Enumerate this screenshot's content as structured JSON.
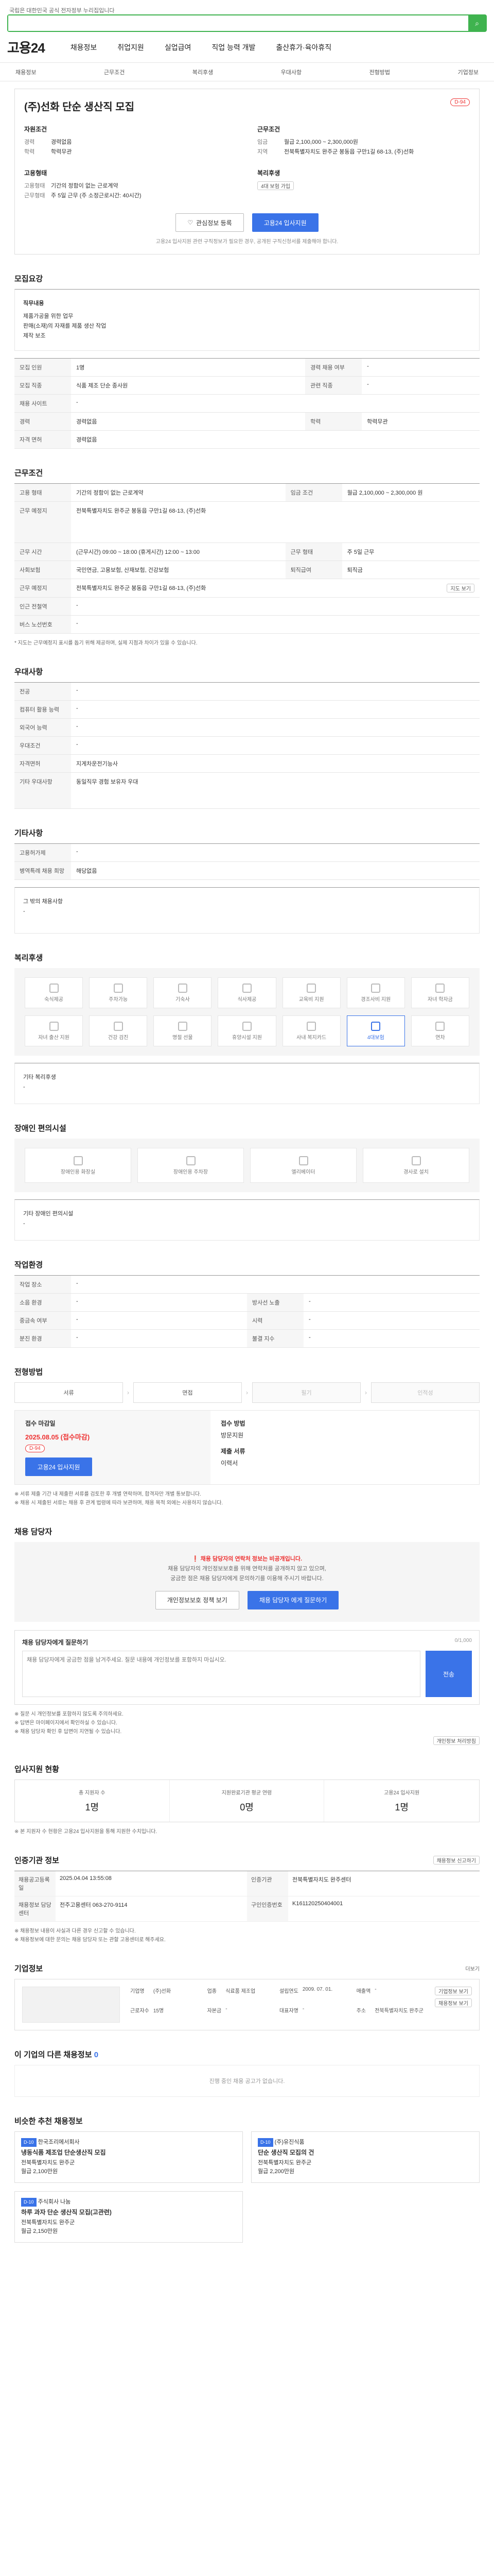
{
  "top_notice": "국립은 대한민국 공식 전자정부 누리집입니다",
  "search": {
    "placeholder": ""
  },
  "brand": {
    "logo": "고용24",
    "accent": "#3fb34f",
    "primary": "#3a73e8"
  },
  "gnb": [
    "채용정보",
    "취업지원",
    "실업급여",
    "직업 능력 개발",
    "출산휴가·육아휴직"
  ],
  "subnav": [
    "채용정보",
    "근무조건",
    "복리후생",
    "우대사항",
    "전형방법",
    "기업정보"
  ],
  "summary": {
    "title": "(주)선화 단순 생산직 모집",
    "dday": "D-94",
    "left_head": "자원조건",
    "left": [
      [
        "경력",
        "경력없음"
      ],
      [
        "학력",
        "학력무관"
      ]
    ],
    "left2_head": "고용형태",
    "left2": [
      [
        "고용형태",
        "기간의 정함이 없는 근로계약"
      ],
      [
        "근무형태",
        "주 5일 근무 (주 소정근로시간: 40시간)"
      ]
    ],
    "right_head": "근무조건",
    "right": [
      [
        "임금",
        "월급 2,100,000 ~ 2,300,000원"
      ],
      [
        "지역",
        "전북특별자치도 완주군 봉동읍 구만1길 68-13, (주)선화"
      ]
    ],
    "right2_head": "복리후생",
    "right2_tag": "4대 보험 가입",
    "btn_like": "관심정보 등록",
    "btn_apply": "고용24 입사지원",
    "note": "고용24 입사지원 관련 구직정보가 필요한 경우, 공개된 구직신청서를 제출해야 합니다."
  },
  "s_recruit": {
    "title": "모집요강",
    "job_title": "직무내용",
    "job_text": [
      "제품가공을 위한 업무",
      "판매(소재)의 자재를 제품 생산 작업",
      "제작 보조"
    ],
    "rows": [
      [
        "모집 인원",
        "1명",
        "경력 채용 여부",
        "-"
      ],
      [
        "모집 직종",
        "식품 제조 단순 종사원",
        "관련 직종",
        "-"
      ],
      [
        "채용 사이트",
        "-",
        "",
        ""
      ],
      [
        "경력",
        "경력없음",
        "학력",
        "학력무관"
      ],
      [
        "자격 면허",
        "경력없음",
        "",
        ""
      ]
    ]
  },
  "s_cond": {
    "title": "근무조건",
    "rows": [
      [
        "고용 형태",
        "기간의 정함이 없는 근로계약",
        "임금 조건",
        "월급 2,100,000 ~ 2,300,000 원"
      ],
      [
        "근무 예정지",
        "전북특별자치도 완주군 봉동읍 구만1길 68-13, (주)선화",
        "",
        ""
      ],
      [
        "근무 시간",
        "(근무시간) 09:00 ~ 18:00 (휴게시간) 12:00 ~ 13:00",
        "근무 형태",
        "주 5일 근무"
      ],
      [
        "사회보험",
        "국민연금, 고용보험, 산재보험, 건강보험",
        "퇴직급여",
        "퇴직금"
      ],
      [
        "근무 예정지",
        "전북특별자치도 완주군 봉동읍 구만1길 68-13, (주)선화",
        "",
        ""
      ],
      [
        "인근 전철역",
        "-",
        "",
        ""
      ],
      [
        "버스 노선번호",
        "-",
        "",
        ""
      ]
    ],
    "map_btn": "지도 보기",
    "note": "* 지도는 근무예정지 표시를 돕기 위해 제공하며, 실제 지점과 차이가 있을 수 있습니다."
  },
  "s_pref": {
    "title": "우대사항",
    "rows": [
      [
        "전공",
        "-"
      ],
      [
        "컴퓨터 활용 능력",
        "-"
      ],
      [
        "외국어 능력",
        "-"
      ],
      [
        "우대조건",
        "-"
      ],
      [
        "자격면허",
        "지게차운전기능사"
      ],
      [
        "기타 우대사항",
        "동일직무 경험 보유자 우대"
      ]
    ]
  },
  "s_etc": {
    "title": "기타사항",
    "rows": [
      [
        "고용허가제",
        "-"
      ],
      [
        "병역특례 채용 희망",
        "해당없음"
      ]
    ],
    "etc_label": "그 밖의 채용사항",
    "etc_value": "-"
  },
  "s_welfare": {
    "title": "복리후생",
    "items": [
      "숙식제공",
      "주차가능",
      "기숙사",
      "식사제공",
      "교육비 지원",
      "경조사비 지원",
      "자녀 학자금",
      "자녀 출산 지원",
      "건강 검진",
      "명절 선물",
      "휴양시설 지원",
      "사내 복지카드",
      "4대보험",
      "연차"
    ],
    "extra_label": "기타 복리후생",
    "extra_value": "-"
  },
  "s_disabled": {
    "title": "장애인 편의시설",
    "items": [
      "장애인용 화장실",
      "장애인용 주차장",
      "엘리베이터",
      "경사로 설치"
    ],
    "extra_label": "기타 장애인 편의시설",
    "extra_value": "-"
  },
  "s_env": {
    "title": "작업환경",
    "rows": [
      [
        "작업 장소",
        "-",
        "",
        ""
      ],
      [
        "소음 환경",
        "-",
        "방사선 노출",
        "-"
      ],
      [
        "중금속 여부",
        "-",
        "시력",
        "-"
      ],
      [
        "분진 환경",
        "-",
        "불결 지수",
        "-"
      ]
    ]
  },
  "s_proc": {
    "title": "전형방법",
    "steps": [
      "서류",
      "면접",
      "필기",
      "인적성"
    ],
    "deadline_label": "접수 마감일",
    "deadline": "2025.08.05 (접수마감)",
    "dday": "D-94",
    "apply_btn": "고용24 입사지원",
    "method_label": "접수 방법",
    "method": "방문지원",
    "docs_label": "제출 서류",
    "docs": "이력서",
    "notes": [
      "※ 서류 제출 기간 내 제출한 서류를 검토한 후 개별 연락하며, 합격자만 개별 통보합니다.",
      "※ 채용 시 제출된 서류는 채용 후 관계 법령에 따라 보관하며, 채용 목적 외에는 사용하지 않습니다."
    ]
  },
  "s_contact": {
    "title": "채용 담당자",
    "alert": "채용 담당자의 연락처 정보는 비공개입니다.",
    "desc1": "채용 담당자의 개인정보보호를 위해 연락처를 공개하지 않고 있으며,",
    "desc2": "궁금한 점은 채용 담당자에게 문의하기를 이용해 주시기 바랍니다.",
    "btn1": "개인정보보호 정책 보기",
    "btn2": "채용 담당자 에게 질문하기",
    "qa_title": "채용 담당자에게 질문하기",
    "qa_counter": "0/1,000",
    "qa_placeholder": "채용 담당자에게 궁금한 점을 남겨주세요. 질문 내용에 개인정보를 포함하지 마십시오.",
    "qa_btn": "전송",
    "qa_notes": [
      "※ 질문 시 개인정보를 포함하지 않도록 주의하세요.",
      "※ 답변은 마이페이지에서 확인하실 수 있습니다.",
      "※ 채용 담당자 확인 후 답변이 지연될 수 있습니다."
    ],
    "qa_link": "개인정보 처리방침"
  },
  "s_stats": {
    "title": "입사지원 현황",
    "items": [
      [
        "총 지원자 수",
        "1명"
      ],
      [
        "지원완료기관 평균 연령",
        "0명"
      ],
      [
        "고용24 입사지원",
        "1명"
      ]
    ],
    "note": "※ 본 지원자 수 현황은 고용24 입사지원을 통해 지원한 수치입니다."
  },
  "s_manage": {
    "title": "인증기관 정보",
    "btn": "채용정보 신고하기",
    "rows": [
      [
        "채용공고등록일",
        "2025.04.04 13:55:08",
        "인증기관",
        "전북특별자치도 완주센터"
      ],
      [
        "채용정보 담당센터",
        "전주고용센터 063-270-9114",
        "구인인증번호",
        "K161120250404001"
      ]
    ],
    "notes": [
      "※ 채용정보 내용이 사실과 다른 경우 신고할 수 있습니다.",
      "※ 채용정보에 대한 문의는 채용 담당자 또는 관할 고용센터로 해주세요."
    ]
  },
  "s_company": {
    "title": "기업정보",
    "more": "더보기",
    "info": [
      [
        "기업명",
        "(주)선화"
      ],
      [
        "업종",
        "식료품 제조업"
      ],
      [
        "설립연도",
        "2009. 07. 01."
      ],
      [
        "매출액",
        "-"
      ],
      [
        "근로자수",
        "15명"
      ],
      [
        "자본금",
        "-"
      ],
      [
        "대표자명",
        "-"
      ],
      [
        "주소",
        "전북특별자치도 완주군"
      ]
    ],
    "btn1": "기업정보 보기",
    "btn2": "채용정보 보기"
  },
  "s_others": {
    "title": "이 기업의 다른 채용정보",
    "count": "0",
    "empty": "진행 중인 채용 공고가 없습니다."
  },
  "s_recommend": {
    "title": "비슷한 추천 채용정보",
    "items": [
      {
        "tag": "D-10",
        "name": "한국조리에서회사",
        "title": "냉동식품 제조업 단순생산직 모집",
        "place": "전북특별자치도 완주군",
        "pay": "월급 2,100만원"
      },
      {
        "tag": "D-10",
        "name": "(주)유진식품",
        "title": "단순 생산직 모집의 건",
        "place": "전북특별자치도 완주군",
        "pay": "월급 2,200만원"
      },
      {
        "tag": "D-10",
        "name": "주식회사 나눔",
        "title": "하루 과자 단순 생산직 모집(고관련)",
        "place": "전북특별자치도 완주군",
        "pay": "월급 2,150만원"
      }
    ]
  }
}
